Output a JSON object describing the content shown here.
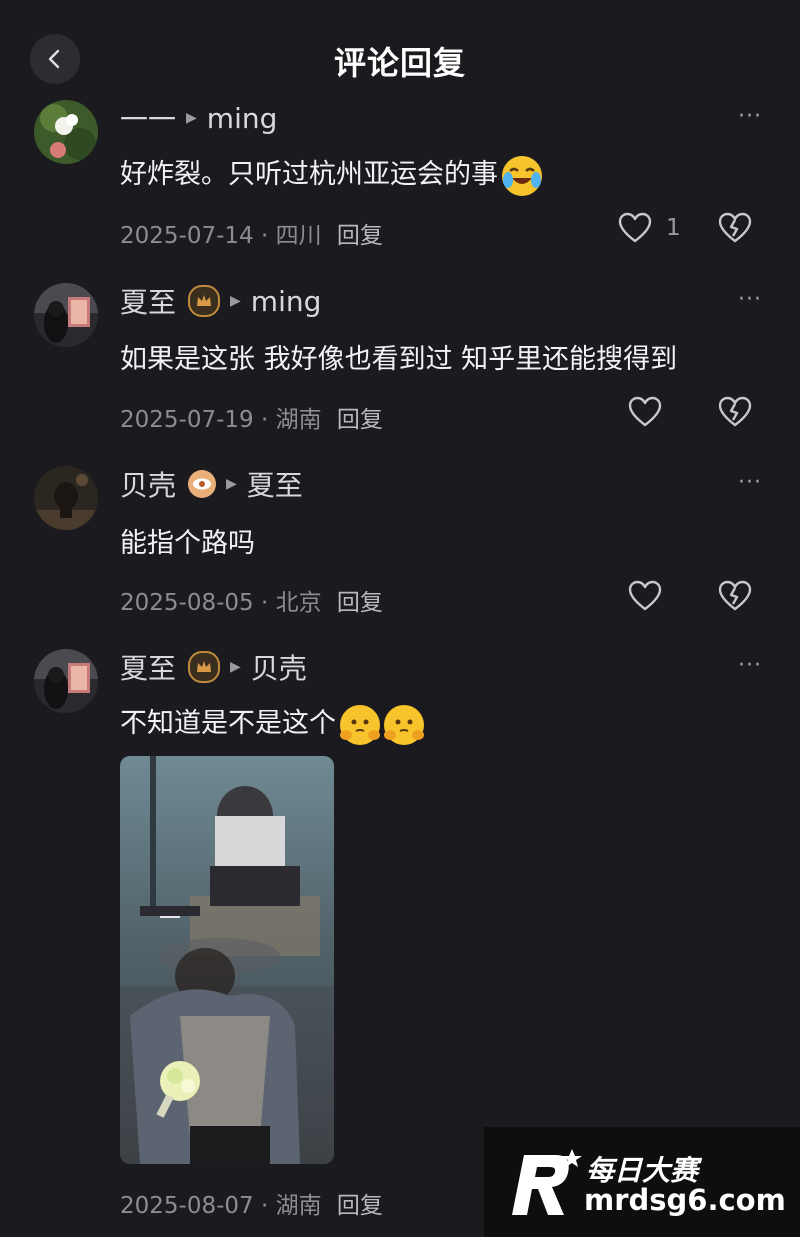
{
  "header": {
    "title": "评论回复"
  },
  "comments": [
    {
      "author": "一一",
      "reply_to": "ming",
      "text": "好炸裂。只听过杭州亚运会的事",
      "emoji": "crying-laughing-emoji",
      "date": "2025-07-14",
      "location": "四川",
      "reply_label": "回复",
      "likes": "1"
    },
    {
      "author": "夏至",
      "reply_to": "ming",
      "badge": "crown-badge",
      "text": "如果是这张  我好像也看到过  知乎里还能搜得到",
      "date": "2025-07-19",
      "location": "湖南",
      "reply_label": "回复"
    },
    {
      "author": "贝壳",
      "reply_to": "夏至",
      "badge": "eye-badge",
      "text": "能指个路吗",
      "date": "2025-08-05",
      "location": "北京",
      "reply_label": "回复"
    },
    {
      "author": "夏至",
      "reply_to": "贝壳",
      "badge": "crown-badge",
      "text": "不知道是不是这个",
      "emoji": "shy-face-emoji",
      "date": "2025-08-07",
      "location": "湖南",
      "reply_label": "回复"
    }
  ],
  "separator": "·",
  "more_label": "···",
  "watermark": {
    "brand": "每日大赛",
    "url": "mrdsg6.com"
  },
  "colors": {
    "background": "#1b1b1f",
    "accent_badge": "#c08a3e",
    "eye_badge": "#e9b07a"
  }
}
